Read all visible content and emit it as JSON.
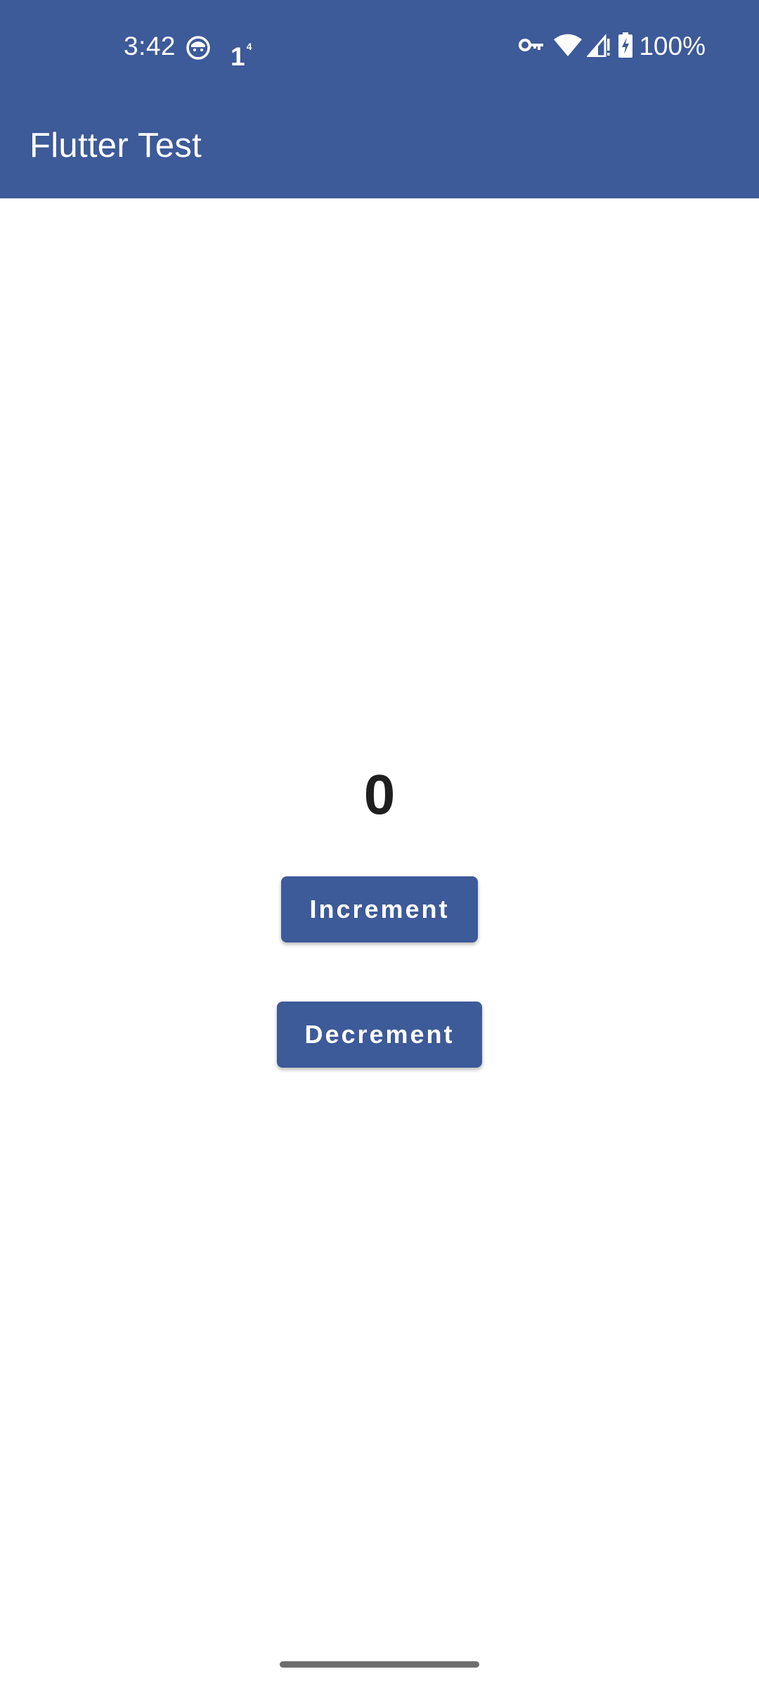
{
  "status_bar": {
    "time": "3:42",
    "notification_count": "1",
    "notification_sup": "4",
    "battery_percent": "100%",
    "icons": [
      "face-icon",
      "key-icon",
      "wifi-icon",
      "signal-icon",
      "battery-charging-icon"
    ]
  },
  "app_bar": {
    "title": "Flutter Test",
    "color": "#3d5a99"
  },
  "main": {
    "counter_value": "0",
    "increment_label": "Increment",
    "decrement_label": "Decrement"
  }
}
